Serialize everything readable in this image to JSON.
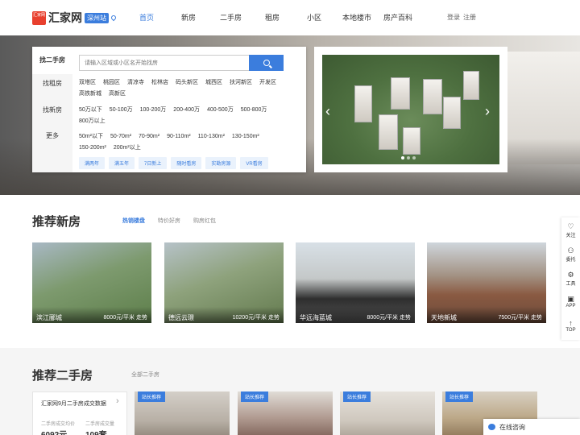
{
  "header": {
    "logo_mark": "汇家网",
    "logo_name": "汇家网",
    "city": "深州站",
    "nav": [
      "首页",
      "新房",
      "二手房",
      "租房",
      "小区",
      "本地楼市",
      "房产百科"
    ],
    "login": "登录",
    "register": "注册"
  },
  "search_panel": {
    "tabs": [
      "找二手房",
      "找租房",
      "找新房",
      "更多"
    ],
    "placeholder": "请输入区域或小区名开始找房",
    "districts_row1": [
      "双塔区",
      "桃园区",
      "清凉寺",
      "松林店",
      "码头新区",
      "城西区",
      "扶河新区",
      "开发区"
    ],
    "districts_row2": [
      "高铁新城",
      "高新区"
    ],
    "prices_row1": [
      "50万以下",
      "50-100万",
      "100-200万",
      "200-400万",
      "400-500万",
      "500-800万"
    ],
    "prices_row2": [
      "800万以上"
    ],
    "areas_row1": [
      "50m²以下",
      "50-70m²",
      "70-90m²",
      "90-110m²",
      "110-130m²",
      "130-150m²"
    ],
    "areas_row2": [
      "150-200m²",
      "200m²以上"
    ],
    "tags": [
      "满两年",
      "满五年",
      "7日新上",
      "随时看房",
      "实勘房源",
      "VR看房"
    ]
  },
  "new_homes": {
    "title": "推荐新房",
    "tabs": [
      "热销楼盘",
      "特价好房",
      "购房红包"
    ],
    "trend": "走势",
    "cards": [
      {
        "name": "滨江郦城",
        "price": "8000元/平米"
      },
      {
        "name": "德远云璟",
        "price": "10200元/平米"
      },
      {
        "name": "华远海蓝城",
        "price": "8000元/平米"
      },
      {
        "name": "天地新城",
        "price": "7500元/平米"
      }
    ]
  },
  "second_hand": {
    "title": "推荐二手房",
    "all_link": "全部二手房",
    "stats_title": "汇家网9月二手房成交数据",
    "avg_label": "二手房成交均价",
    "avg_value": "6092元",
    "volume_label": "二手房成交量",
    "volume_value": "109套",
    "badge": "站长推荐"
  },
  "sidebar": {
    "items": [
      {
        "label": "关注",
        "icon": "heart-icon"
      },
      {
        "label": "委托",
        "icon": "user-icon"
      },
      {
        "label": "工具",
        "icon": "tool-icon"
      },
      {
        "label": "APP",
        "icon": "qrcode-icon"
      },
      {
        "label": "TOP",
        "icon": "arrow-up-icon"
      }
    ]
  },
  "chat": {
    "label": "在线咨询"
  },
  "colors": {
    "accent": "#3b7ddd",
    "logo": "#e8402e"
  }
}
